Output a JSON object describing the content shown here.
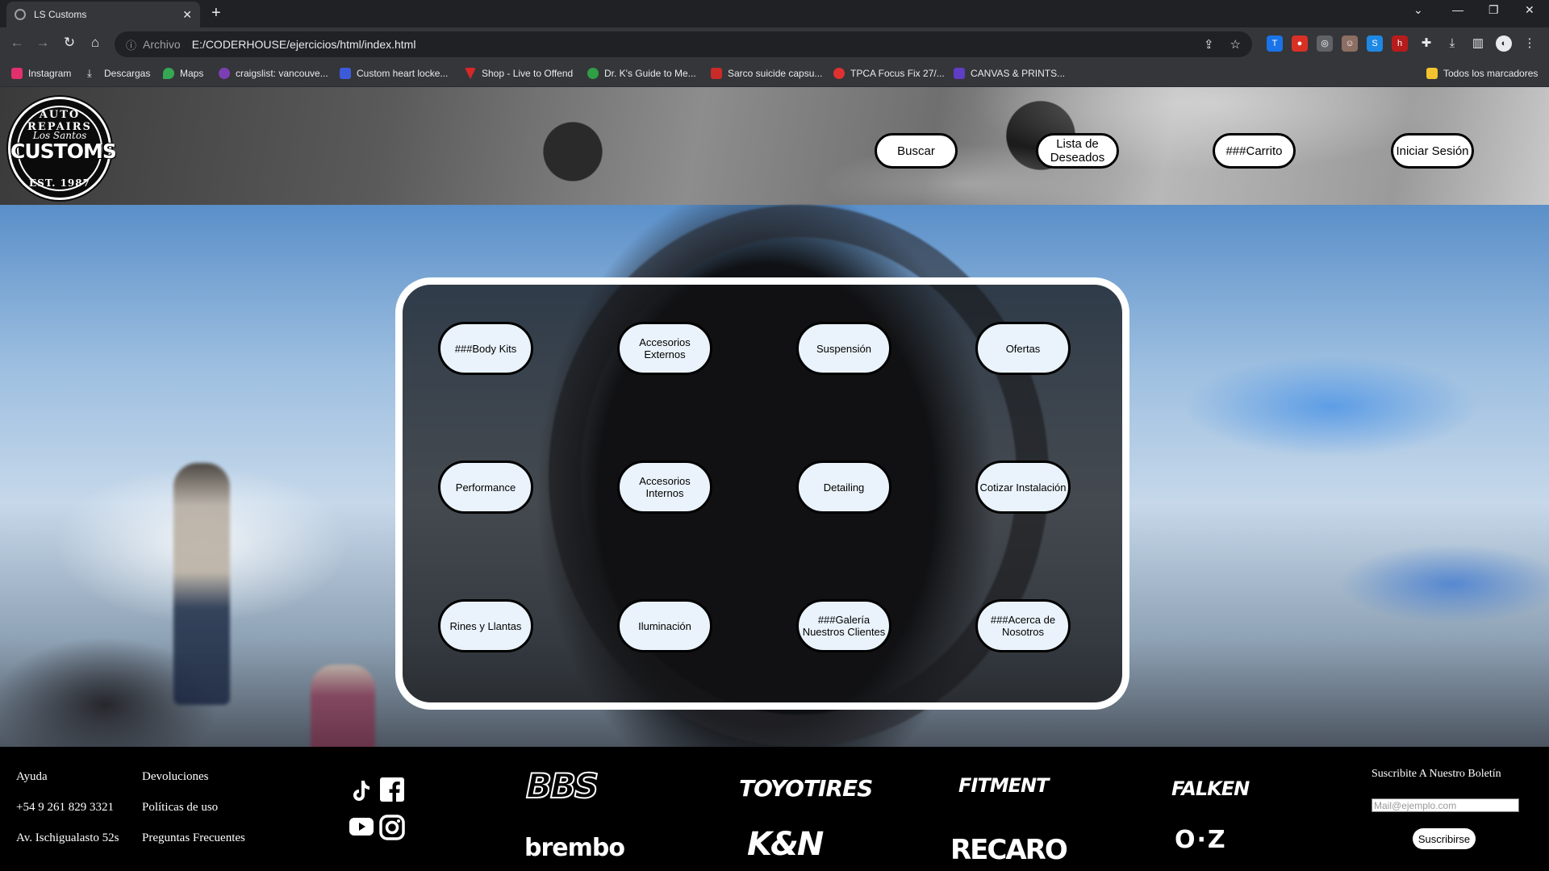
{
  "browser": {
    "tab_title": "LS Customs",
    "address_label": "Archivo",
    "url": "E:/CODERHOUSE/ejercicios/html/index.html",
    "bookmarks": [
      {
        "label": "Instagram",
        "color": "#e1306c"
      },
      {
        "label": "Descargas",
        "color": "#e8eaed"
      },
      {
        "label": "Maps",
        "color": "#34a853"
      },
      {
        "label": "craigslist: vancouve...",
        "color": "#7b3fb3"
      },
      {
        "label": "Custom heart locke...",
        "color": "#3b5bdb"
      },
      {
        "label": "Shop - Live to Offend",
        "color": "#d62828"
      },
      {
        "label": "Dr. K's Guide to Me...",
        "color": "#2f9e44"
      },
      {
        "label": "Sarco suicide capsu...",
        "color": "#c92a2a"
      },
      {
        "label": "TPCA Focus Fix 27/...",
        "color": "#e03131"
      },
      {
        "label": "CANVAS & PRINTS...",
        "color": "#5f3dc4"
      }
    ],
    "all_bookmarks": "Todos los marcadores"
  },
  "header": {
    "logo": {
      "top_text": "AUTO REPAIRS",
      "script_text": "Los Santos",
      "main_text": "CUSTOMS",
      "bottom_text": "EST. 1987"
    },
    "buttons": {
      "buscar": "Buscar",
      "deseados": "Lista de Deseados",
      "carrito": "###Carrito",
      "sesion": "Iniciar Sesión"
    }
  },
  "menu": {
    "items": [
      "###Body Kits",
      "Accesorios Externos",
      "Suspensión",
      "Ofertas",
      "Performance",
      "Accesorios Internos",
      "Detailing",
      "Cotizar Instalación",
      "Rines y Llantas",
      "Iluminación",
      "###Galería Nuestros Clientes",
      "###Acerca de Nosotros"
    ]
  },
  "footer": {
    "col1": [
      "Ayuda",
      "+54 9 261 829 3321",
      "Av. Ischigualasto 52s"
    ],
    "col2": [
      "Devoluciones",
      "Políticas de uso",
      "Preguntas Frecuentes"
    ],
    "social": [
      "tiktok-icon",
      "facebook-icon",
      "youtube-icon",
      "instagram-icon"
    ],
    "brands": [
      "BBS",
      "TOYOTIRES",
      "FITMENT",
      "FALKEN",
      "brembo",
      "K&N",
      "RECARO",
      "O·Z"
    ],
    "newsletter": {
      "title": "Suscribite A Nuestro Boletín",
      "placeholder": "Mail@ejemplo.com",
      "button": "Suscribirse"
    }
  }
}
